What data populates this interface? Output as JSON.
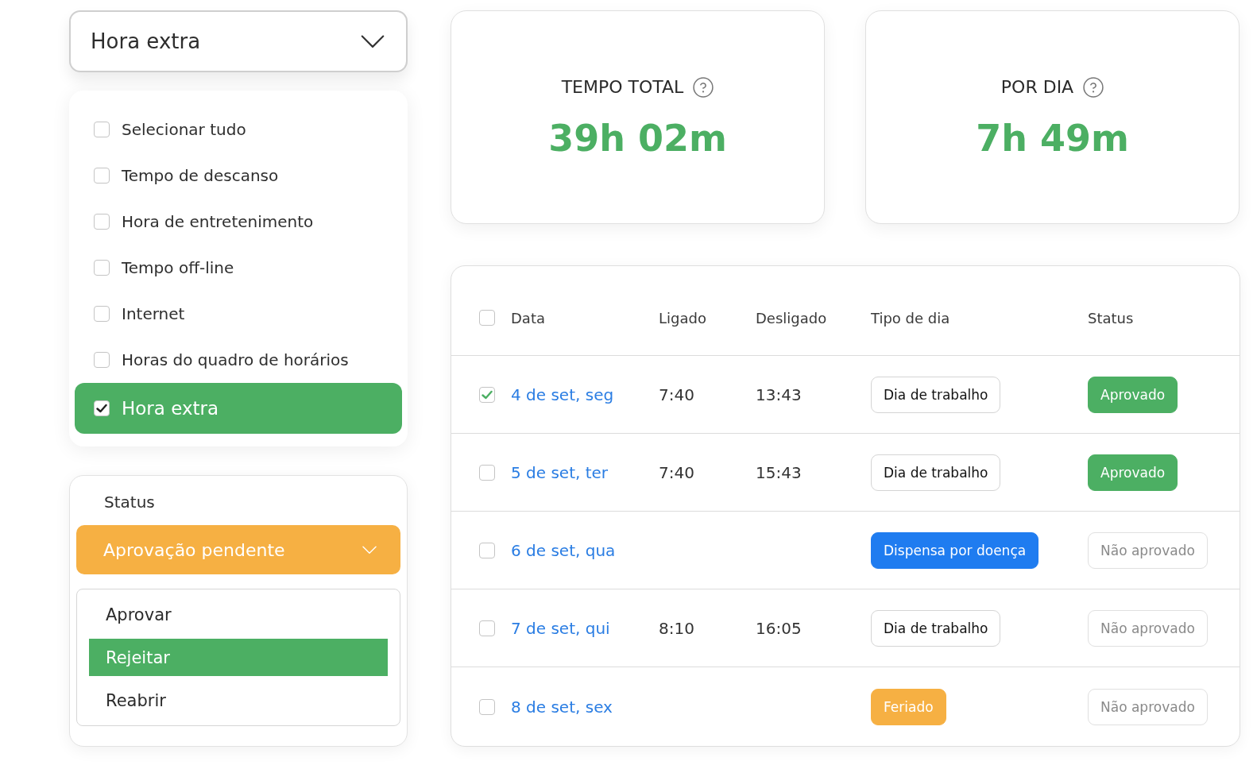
{
  "type_dropdown": {
    "value": "Hora extra"
  },
  "type_options": [
    {
      "label": "Selecionar tudo",
      "checked": false,
      "selected": false
    },
    {
      "label": "Tempo de descanso",
      "checked": false,
      "selected": false
    },
    {
      "label": "Hora de entretenimento",
      "checked": false,
      "selected": false
    },
    {
      "label": "Tempo off-line",
      "checked": false,
      "selected": false
    },
    {
      "label": "Internet",
      "checked": false,
      "selected": false
    },
    {
      "label": "Horas do quadro de horários",
      "checked": false,
      "selected": false
    },
    {
      "label": "Hora extra",
      "checked": true,
      "selected": true
    }
  ],
  "status_panel": {
    "label": "Status",
    "select": {
      "value": "Aprovação pendente"
    },
    "menu": [
      {
        "label": "Aprovar",
        "selected": false
      },
      {
        "label": "Rejeitar",
        "selected": true
      },
      {
        "label": "Reabrir",
        "selected": false
      }
    ]
  },
  "stats": [
    {
      "label": "TEMPO TOTAL",
      "value": "39h 02m"
    },
    {
      "label": "POR DIA",
      "value": "7h 49m"
    }
  ],
  "table": {
    "select_all_checked": false,
    "columns": [
      "Data",
      "Ligado",
      "Desligado",
      "Tipo de dia",
      "Status"
    ],
    "rows": [
      {
        "checked": true,
        "date": "4 de set, seg",
        "clock_in": "7:40",
        "clock_out": "13:43",
        "day_type": {
          "label": "Dia de trabalho",
          "kind": "workday"
        },
        "status": {
          "label": "Aprovado",
          "kind": "approved"
        }
      },
      {
        "checked": false,
        "date": "5 de set, ter",
        "clock_in": "7:40",
        "clock_out": "15:43",
        "day_type": {
          "label": "Dia de trabalho",
          "kind": "workday"
        },
        "status": {
          "label": "Aprovado",
          "kind": "approved"
        }
      },
      {
        "checked": false,
        "date": "6 de set, qua",
        "day_type": {
          "label": "Dispensa por doença",
          "kind": "sick_leave"
        },
        "status": {
          "label": "Não aprovado",
          "kind": "not_approved"
        }
      },
      {
        "checked": false,
        "date": "7 de set, qui",
        "clock_in": "8:10",
        "clock_out": "16:05",
        "day_type": {
          "label": "Dia de trabalho",
          "kind": "workday"
        },
        "status": {
          "label": "Não aprovado",
          "kind": "not_approved"
        }
      },
      {
        "checked": false,
        "date": "8 de set, sex",
        "day_type": {
          "label": "Feriado",
          "kind": "holiday"
        },
        "status": {
          "label": "Não aprovado",
          "kind": "not_approved"
        }
      }
    ]
  }
}
